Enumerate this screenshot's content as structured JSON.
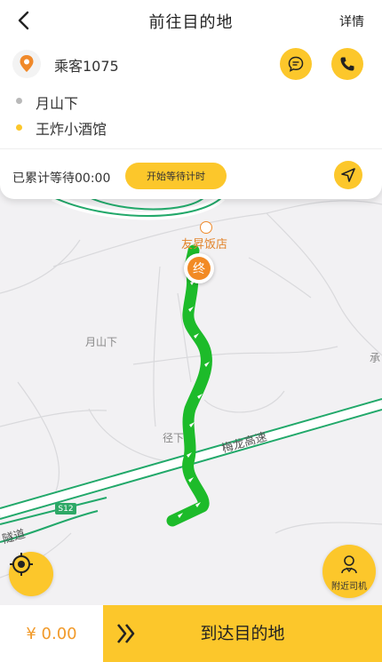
{
  "header": {
    "title": "前往目的地",
    "detail_label": "详情"
  },
  "order": {
    "passenger_label": "乘客1075",
    "pickup_address": "月山下",
    "destination_address": "王炸小酒馆",
    "wait_text": "已累计等待00:00",
    "start_wait_label": "开始等待计时"
  },
  "map": {
    "poi_name": "友昇饭店",
    "end_marker_label": "终",
    "place_label_1": "月山下",
    "place_label_2": "径下",
    "place_label_3": "承",
    "road_label_1": "梅龙高速",
    "road_label_2": "隧道",
    "highway_shield": "S12"
  },
  "controls": {
    "nearby_driver_label": "附近司机"
  },
  "footer": {
    "price": "¥ 0.00",
    "arrive_label": "到达目的地"
  },
  "colors": {
    "accent": "#fcc72b",
    "route": "#1dbb2a",
    "price": "#f19a2a",
    "road_green": "#2ea866",
    "marker": "#f28a24"
  }
}
